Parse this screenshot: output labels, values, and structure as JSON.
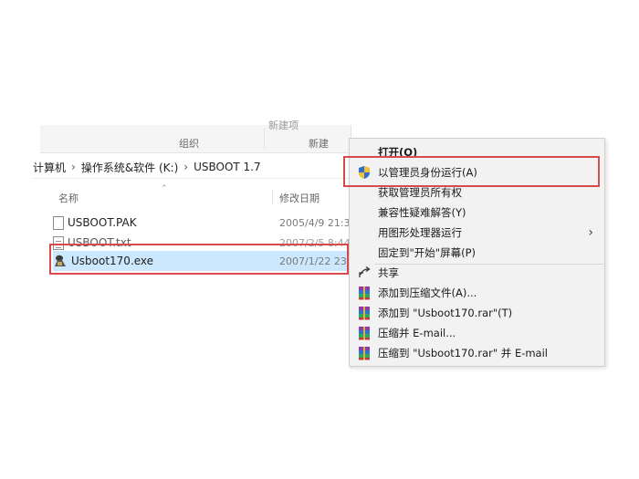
{
  "ribbon": {
    "top_clipped": "新建项",
    "group_organize": "组织",
    "group_new": "新建"
  },
  "address": {
    "part0": "计算机",
    "part1": "操作系统&软件 (K:)",
    "part2": "USBOOT 1.7"
  },
  "columns": {
    "name": "名称",
    "date": "修改日期"
  },
  "files": [
    {
      "name": "USBOOT.PAK",
      "date": "2005/4/9 21:3",
      "type": "file"
    },
    {
      "name": "USBOOT.txt",
      "date": "2007/2/5 8:44",
      "type": "txt"
    },
    {
      "name": "Usboot170.exe",
      "date": "2007/1/22 23:",
      "type": "exe",
      "selected": true
    }
  ],
  "menu": {
    "open": "打开(O)",
    "run_as_admin": "以管理员身份运行(A)",
    "take_ownership": "获取管理员所有权",
    "troubleshoot": "兼容性疑难解答(Y)",
    "run_with_gpu": "用图形处理器运行",
    "pin_start": "固定到\"开始\"屏幕(P)",
    "share": "共享",
    "add_archive": "添加到压缩文件(A)...",
    "add_rar": "添加到 \"Usboot170.rar\"(T)",
    "compress_email": "压缩并 E-mail...",
    "compress_rar_email": "压缩到 \"Usboot170.rar\" 并 E-mail",
    "submenu_arrow": "›"
  },
  "colors": {
    "highlight_border": "#d94a4a",
    "selection": "#cce8ff",
    "menu_bg": "#f2f2f2"
  }
}
